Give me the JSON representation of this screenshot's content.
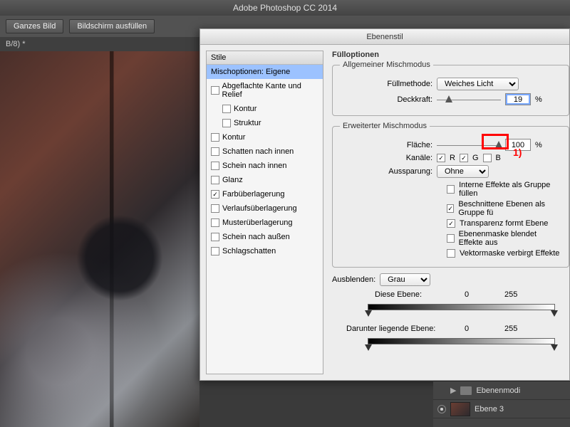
{
  "app_title": "Adobe Photoshop CC 2014",
  "toolbar": {
    "ganzes_bild": "Ganzes Bild",
    "bildschirm": "Bildschirm ausfüllen"
  },
  "doc_tab": "B/8) *",
  "dialog_title": "Ebenenstil",
  "styles": {
    "header": "Stile",
    "items": [
      {
        "label": "Mischoptionen: Eigene",
        "checked": null,
        "selected": true,
        "sub": false
      },
      {
        "label": "Abgeflachte Kante und Relief",
        "checked": false,
        "sub": false
      },
      {
        "label": "Kontur",
        "checked": false,
        "sub": true
      },
      {
        "label": "Struktur",
        "checked": false,
        "sub": true
      },
      {
        "label": "Kontur",
        "checked": false,
        "sub": false
      },
      {
        "label": "Schatten nach innen",
        "checked": false,
        "sub": false
      },
      {
        "label": "Schein nach innen",
        "checked": false,
        "sub": false
      },
      {
        "label": "Glanz",
        "checked": false,
        "sub": false
      },
      {
        "label": "Farbüberlagerung",
        "checked": true,
        "sub": false
      },
      {
        "label": "Verlaufsüberlagerung",
        "checked": false,
        "sub": false
      },
      {
        "label": "Musterüberlagerung",
        "checked": false,
        "sub": false
      },
      {
        "label": "Schein nach außen",
        "checked": false,
        "sub": false
      },
      {
        "label": "Schlagschatten",
        "checked": false,
        "sub": false
      }
    ]
  },
  "fill": {
    "legend": "Fülloptionen",
    "general_legend": "Allgemeiner Mischmodus",
    "fuellmethode_label": "Füllmethode:",
    "fuellmethode_value": "Weiches Licht",
    "deckkraft_label": "Deckkraft:",
    "deckkraft_value": "19",
    "pct": "%"
  },
  "adv": {
    "legend": "Erweiterter Mischmodus",
    "flaeche_label": "Fläche:",
    "flaeche_value": "100",
    "kanaele_label": "Kanäle:",
    "r": "R",
    "g": "G",
    "b": "B",
    "r_checked": true,
    "g_checked": true,
    "b_checked": false,
    "aussparung_label": "Aussparung:",
    "aussparung_value": "Ohne",
    "opts": [
      {
        "label": "Interne Effekte als Gruppe füllen",
        "checked": false
      },
      {
        "label": "Beschnittene Ebenen als Gruppe fü",
        "checked": true
      },
      {
        "label": "Transparenz formt Ebene",
        "checked": true
      },
      {
        "label": "Ebenenmaske blendet Effekte aus",
        "checked": false
      },
      {
        "label": "Vektormaske verbirgt Effekte",
        "checked": false
      }
    ]
  },
  "blendif": {
    "ausblenden_label": "Ausblenden:",
    "ausblenden_value": "Grau",
    "diese_ebene": "Diese Ebene:",
    "darunter": "Darunter liegende Ebene:",
    "v0": "0",
    "v255": "255"
  },
  "annotation": "1)",
  "layers": {
    "group": "Ebenenmodi",
    "layer": "Ebene 3"
  }
}
